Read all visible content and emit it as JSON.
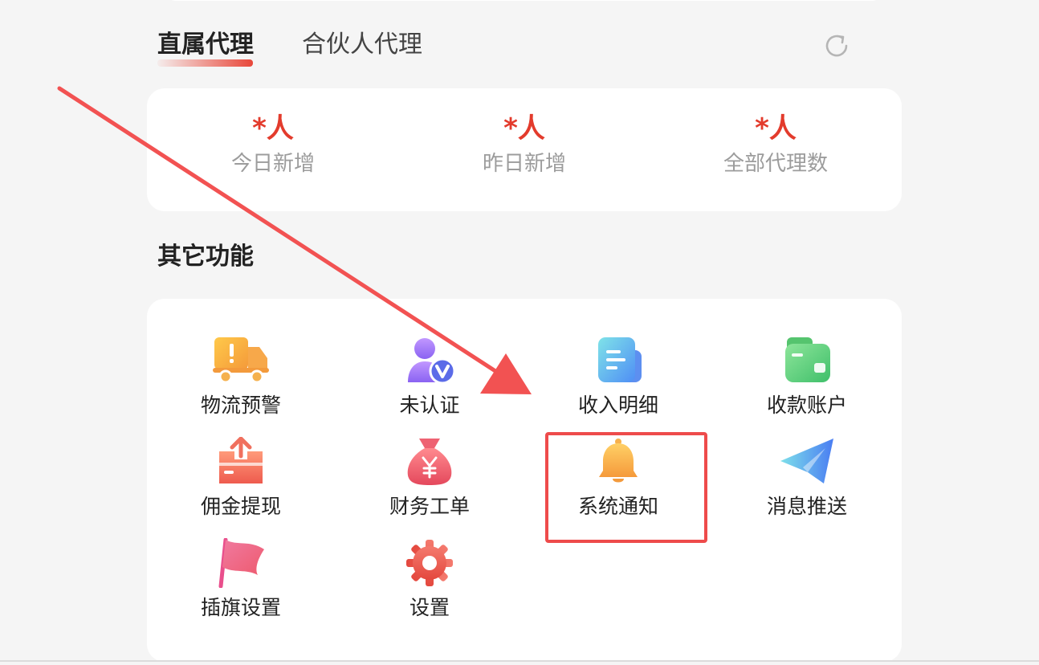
{
  "tabs": {
    "active_label": "直属代理",
    "inactive_label": "合伙人代理"
  },
  "stats": [
    {
      "value": "*人",
      "label": "今日新增"
    },
    {
      "value": "*人",
      "label": "昨日新增"
    },
    {
      "value": "*人",
      "label": "全部代理数"
    }
  ],
  "section": {
    "title": "其它功能"
  },
  "functions": [
    {
      "label": "物流预警",
      "icon": "truck-warning-icon"
    },
    {
      "label": "未认证",
      "icon": "unverified-user-icon"
    },
    {
      "label": "收入明细",
      "icon": "income-document-icon"
    },
    {
      "label": "收款账户",
      "icon": "wallet-icon"
    },
    {
      "label": "佣金提现",
      "icon": "withdraw-box-icon"
    },
    {
      "label": "财务工单",
      "icon": "money-bag-icon"
    },
    {
      "label": "系统通知",
      "icon": "bell-icon"
    },
    {
      "label": "消息推送",
      "icon": "paper-plane-icon"
    },
    {
      "label": "插旗设置",
      "icon": "flag-icon"
    },
    {
      "label": "设置",
      "icon": "gear-icon"
    }
  ],
  "colors": {
    "accent_red": "#e33b2c",
    "annotation_red": "#ee4b4b",
    "background": "#f5f5f5"
  }
}
